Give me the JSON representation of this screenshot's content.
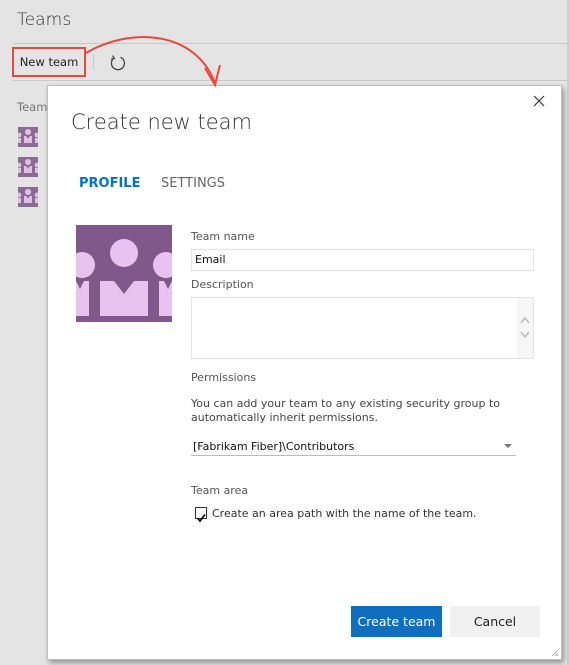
{
  "page": {
    "title": "Teams",
    "list_label": "Team",
    "team_count_visible": 3
  },
  "toolbar": {
    "new_team_label": "New team",
    "refresh_icon": "refresh-icon",
    "highlight_color": "#e8493a"
  },
  "dialog": {
    "title": "Create new team",
    "close_icon": "close-icon",
    "tabs": [
      {
        "label": "PROFILE",
        "active": true
      },
      {
        "label": "SETTINGS",
        "active": false
      }
    ],
    "avatar_icon": "team-icon",
    "fields": {
      "team_name_label": "Team name",
      "team_name_value": "Email",
      "description_label": "Description",
      "description_value": "",
      "permissions_label": "Permissions",
      "permissions_help": "You can add your team to any existing security group to automatically inherit permissions.",
      "permissions_value": "[Fabrikam Fiber]\\Contributors",
      "team_area_label": "Team area",
      "area_checkbox_label": "Create an area path with the name of the team.",
      "area_checkbox_checked": true
    },
    "buttons": {
      "create_label": "Create team",
      "cancel_label": "Cancel"
    },
    "colors": {
      "accent": "#0072c6",
      "primary_button": "#106ebe",
      "avatar_bg": "#80588a",
      "avatar_fg": "#e8c3ef"
    }
  }
}
